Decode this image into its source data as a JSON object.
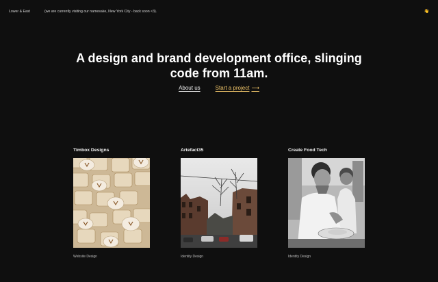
{
  "topbar": {
    "brand": "Lower & East",
    "notice": "(we are currently visiting our namesake, New York City - back soon <3).",
    "wave_icon": "waving-hand-icon",
    "wave_text": "👋"
  },
  "hero": {
    "headline": "A design and brand development office, slinging code from 11am."
  },
  "links": {
    "about": "About us",
    "start": "Start a project",
    "start_arrow": "⟶"
  },
  "projects": [
    {
      "title": "Timbox Designs",
      "category": "Website Design"
    },
    {
      "title": "Artefact35",
      "category": "Identity Design"
    },
    {
      "title": "Create Food Tech",
      "category": "Identity Design"
    }
  ],
  "colors": {
    "background": "#0f0f0f",
    "accent": "#f3c76a",
    "text": "#f2f2f2"
  }
}
